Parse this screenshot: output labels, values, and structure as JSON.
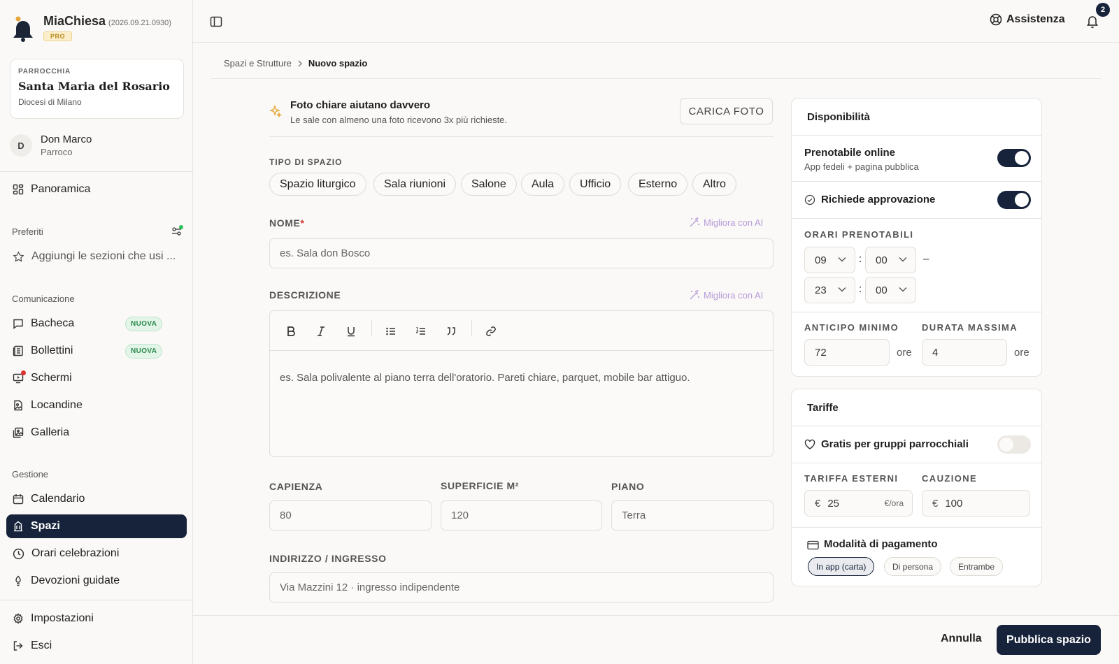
{
  "brand": {
    "name": "MiaChiesa",
    "version": "(2026.09.21.0930)",
    "badge": "PRO"
  },
  "parish": {
    "kicker": "PARROCCHIA",
    "name": "Santa Maria del Rosario",
    "diocese": "Diocesi di Milano"
  },
  "user": {
    "initial": "D",
    "name": "Don Marco",
    "role": "Parroco"
  },
  "nav": {
    "overview": "Panoramica",
    "favorites_label": "Preferiti",
    "favorites_add": "Aggiungi le sezioni che usi ...",
    "communication_label": "Comunicazione",
    "bacheca": "Bacheca",
    "bollettini": "Bollettini",
    "schermi": "Schermi",
    "locandine": "Locandine",
    "galleria": "Galleria",
    "new_badge": "NUOVA",
    "management_label": "Gestione",
    "calendario": "Calendario",
    "spazi": "Spazi",
    "orari": "Orari celebrazioni",
    "devozioni": "Devozioni guidate",
    "impostazioni": "Impostazioni",
    "esci": "Esci"
  },
  "topbar": {
    "help": "Assistenza",
    "notifications": "2"
  },
  "breadcrumb": {
    "parent": "Spazi e Strutture",
    "current": "Nuovo spazio"
  },
  "tip": {
    "title": "Foto chiare aiutano davvero",
    "subtitle": "Le sale con almeno una foto ricevono 3x più richieste.",
    "upload": "CARICA FOTO"
  },
  "form": {
    "type_label": "TIPO DI SPAZIO",
    "types": [
      "Spazio liturgico",
      "Sala riunioni",
      "Salone",
      "Aula",
      "Ufficio",
      "Esterno",
      "Altro"
    ],
    "name_label": "NOME",
    "required_mark": "*",
    "name_placeholder": "es. Sala don Bosco",
    "ai_improve": "Migliora con AI",
    "desc_label": "DESCRIZIONE",
    "desc_placeholder": "es. Sala polivalente al piano terra dell'oratorio. Pareti chiare, parquet, mobile bar attiguo.",
    "capacity_label": "CAPIENZA",
    "capacity_placeholder": "80",
    "surface_label": "SUPERFICIE M²",
    "surface_placeholder": "120",
    "floor_label": "PIANO",
    "floor_placeholder": "Terra",
    "address_label": "INDIRIZZO / INGRESSO",
    "address_placeholder": "Via Mazzini 12 · ingresso indipendente"
  },
  "availability": {
    "title": "Disponibilità",
    "online_title": "Prenotabile online",
    "online_sub": "App fedeli + pagina pubblica",
    "online_on": true,
    "approval": "Richiede approvazione",
    "approval_on": true,
    "hours_label": "ORARI PRENOTABILI",
    "start_hour": "09",
    "start_min": "00",
    "end_hour": "23",
    "end_min": "00",
    "colon": ":",
    "dash": "–",
    "advance_label": "ANTICIPO MINIMO",
    "advance_value": "72",
    "max_label": "DURATA MASSIMA",
    "max_value": "4",
    "unit": "ore"
  },
  "rates": {
    "title": "Tariffe",
    "free_label": "Gratis per gruppi parrocchiali",
    "free_on": false,
    "ext_label": "TARIFFA ESTERNI",
    "ext_value": "25",
    "ext_unit": "€/ora",
    "deposit_label": "CAUZIONE",
    "deposit_value": "100",
    "currency": "€",
    "payment_label": "Modalità di pagamento",
    "payment_options": [
      "In app (carta)",
      "Di persona",
      "Entrambe"
    ]
  },
  "footer": {
    "cancel": "Annulla",
    "publish": "Pubblica spazio"
  },
  "colors": {
    "primary": "#17233a",
    "ai": "#b69bd9",
    "new_badge": "#2a8a4b",
    "danger": "#e0322f",
    "star": "#e5a73a"
  }
}
